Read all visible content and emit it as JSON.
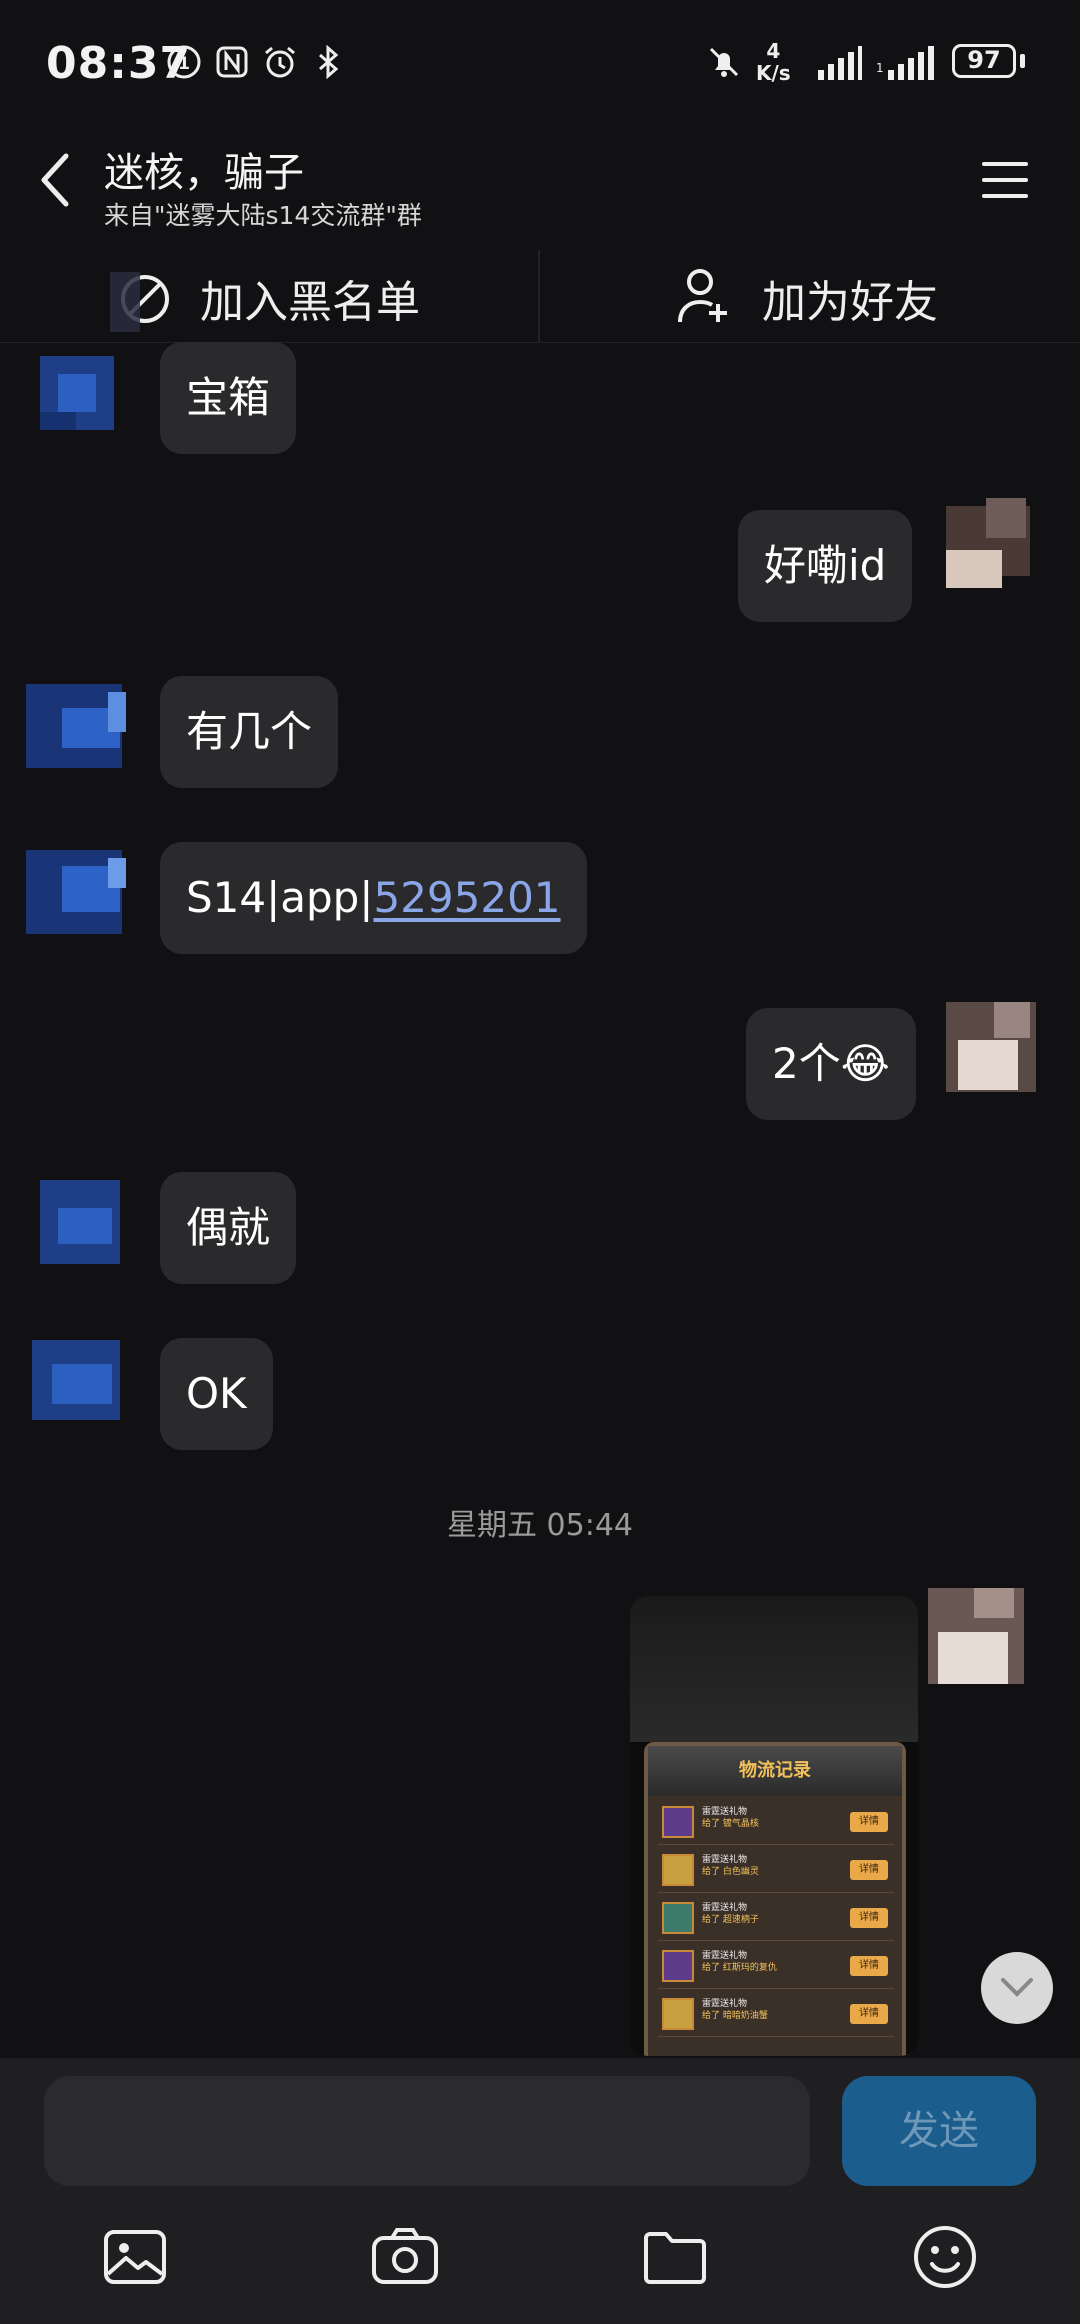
{
  "status_bar": {
    "time": "08:37",
    "net_speed_value": "4",
    "net_speed_unit": "K/s",
    "battery": "97"
  },
  "header": {
    "title": "迷核，骗子",
    "subtitle": "来自\"迷雾大陆s14交流群\"群"
  },
  "actions": {
    "blacklist": "加入黑名单",
    "add_friend": "加为好友"
  },
  "messages": [
    {
      "side": "left",
      "text": "宝箱"
    },
    {
      "side": "right",
      "text": "好嘞id"
    },
    {
      "side": "left",
      "text": "有几个"
    },
    {
      "side": "left",
      "text_prefix": "S14|app|",
      "link": "5295201"
    },
    {
      "side": "right",
      "text": "2个",
      "emoji": "😂"
    },
    {
      "side": "left",
      "text": "偶就"
    },
    {
      "side": "left",
      "text": "OK"
    }
  ],
  "timestamp": "星期五 05:44",
  "image_message": {
    "title": "物流记录",
    "rows": [
      {
        "from": "雷霆送礼物",
        "gift": "给了 镀气晶核",
        "btn": "详情"
      },
      {
        "from": "雷霆送礼物",
        "gift": "给了 白色幽灵",
        "btn": "详情"
      },
      {
        "from": "雷霆送礼物",
        "gift": "给了 超速柄子",
        "btn": "详情"
      },
      {
        "from": "雷霆送礼物",
        "gift": "给了 红斯玛的复仇",
        "btn": "详情"
      },
      {
        "from": "雷霆送礼物",
        "gift": "给了 暗暗奶油蟹",
        "btn": "详情"
      }
    ]
  },
  "input": {
    "placeholder": "",
    "send_label": "发送"
  },
  "colors": {
    "background": "#111113",
    "bubble": "#2a2a2c",
    "link": "#8aa6e8",
    "send_button": "#1b5e8e"
  },
  "icons": {
    "back": "chevron-left-icon",
    "menu": "hamburger-menu-icon",
    "blacklist": "block-icon",
    "add_friend": "person-add-icon",
    "scroll_down": "chevron-down-icon",
    "photo": "image-icon",
    "camera": "camera-icon",
    "folder": "folder-icon",
    "emoji": "smiley-icon"
  }
}
